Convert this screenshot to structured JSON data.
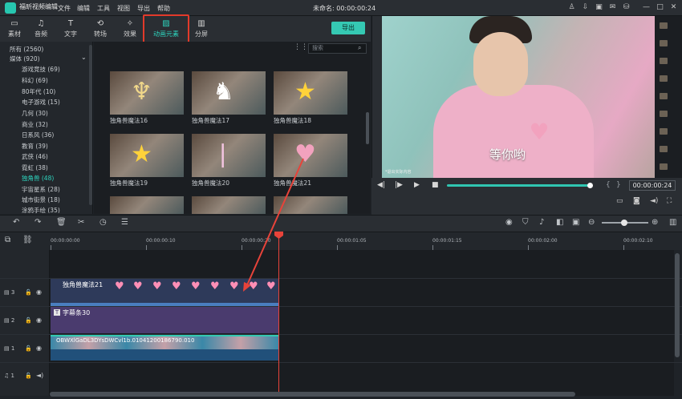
{
  "app": {
    "name": "福昕视频编辑",
    "project_title": "未命名: 00:00:00:24",
    "menu": [
      "文件",
      "编辑",
      "工具",
      "视图",
      "导出",
      "帮助"
    ]
  },
  "tabs": [
    {
      "label": "素材",
      "icon": "folder-icon"
    },
    {
      "label": "音频",
      "icon": "music-icon"
    },
    {
      "label": "文字",
      "icon": "text-icon"
    },
    {
      "label": "转场",
      "icon": "transition-icon"
    },
    {
      "label": "效果",
      "icon": "effects-icon"
    },
    {
      "label": "动画元素",
      "icon": "image-icon"
    },
    {
      "label": "分屏",
      "icon": "split-icon"
    }
  ],
  "toolbar": {
    "export_label": "导出"
  },
  "search": {
    "placeholder": "搜索"
  },
  "sidebar": {
    "items": [
      {
        "label": "所有 (2560)"
      },
      {
        "label": "媒体 (920)"
      },
      {
        "label": "游戏竞技 (69)"
      },
      {
        "label": "科幻 (69)"
      },
      {
        "label": "80年代 (10)"
      },
      {
        "label": "电子游戏 (15)"
      },
      {
        "label": "几何 (30)"
      },
      {
        "label": "商业 (32)"
      },
      {
        "label": "日系风 (36)"
      },
      {
        "label": "教育 (39)"
      },
      {
        "label": "武侠 (46)"
      },
      {
        "label": "霓虹 (38)"
      },
      {
        "label": "独角兽 (48)"
      },
      {
        "label": "宇宙星系 (28)"
      },
      {
        "label": "城市街景 (18)"
      },
      {
        "label": "涂鸦手绘 (35)"
      }
    ]
  },
  "assets": [
    {
      "label": "独角兽魔法16",
      "glyph": "harp"
    },
    {
      "label": "独角兽魔法17",
      "glyph": "unicorn"
    },
    {
      "label": "独角兽魔法18",
      "glyph": "rainbow-star"
    },
    {
      "label": "独角兽魔法19",
      "glyph": "shooting-star"
    },
    {
      "label": "独角兽魔法20",
      "glyph": "horn"
    },
    {
      "label": "独角兽魔法21",
      "glyph": "heart"
    }
  ],
  "preview": {
    "caption": "等你哟",
    "note": "*退出实际内容",
    "time": "00:00:00:24",
    "progress": 0.97
  },
  "timeline": {
    "ticks": [
      "00:00:00:00",
      "00:00:00:10",
      "00:00:00:20",
      "00:00:01:05",
      "00:00:01:15",
      "00:00:02:00",
      "00:00:02:10"
    ],
    "tracks": [
      {
        "label": "3"
      },
      {
        "label": "2"
      },
      {
        "label": "1"
      },
      {
        "label": "1"
      }
    ],
    "clips": {
      "anim": "独角兽魔法21",
      "text": "字幕条30",
      "video": "OBWXlGaDL3DYsDWCvl1b.01041200186790.010"
    }
  },
  "colors": {
    "accent": "#2ed3bd",
    "playhead": "#e8433a",
    "highlight": "#e23a2a"
  }
}
